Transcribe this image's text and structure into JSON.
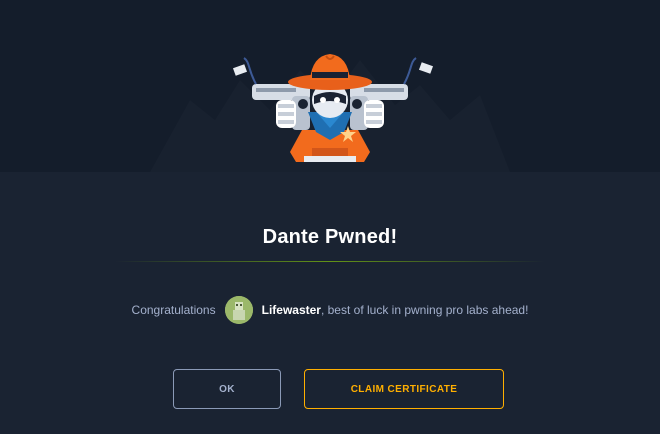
{
  "dialog": {
    "title": "Dante Pwned!",
    "message_prefix": "Congratulations",
    "username": "Lifewaster",
    "message_suffix": ", best of luck in pwning pro labs ahead!"
  },
  "buttons": {
    "ok_label": "OK",
    "claim_label": "CLAIM CERTIFICATE"
  },
  "colors": {
    "background": "#1a2332",
    "banner": "#141d2b",
    "accent_orange": "#ffaf00",
    "hat_orange": "#f26b1d",
    "divider_green": "#9fef00"
  },
  "icons": {
    "banner": "cowboy-mascot-with-pistols",
    "avatar": "user-avatar"
  }
}
